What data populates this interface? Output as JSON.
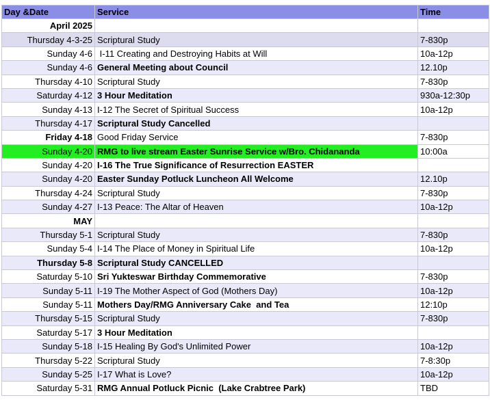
{
  "table": {
    "headers": {
      "date": "Day &Date",
      "service": "Service",
      "time": "Time"
    },
    "rows": [
      {
        "date": "April 2025",
        "service": "",
        "time": "",
        "date_bold": true,
        "service_bold": false,
        "shade": "white"
      },
      {
        "date": "Thursday 4-3-25",
        "service": "Scriptural Study",
        "time": "7-830p",
        "date_bold": false,
        "service_bold": false,
        "shade": "lilac"
      },
      {
        "date": "Sunday 4-6",
        "service": " I-11 Creating and Destroying Habits at Will",
        "time": "10a-12p",
        "date_bold": false,
        "service_bold": false,
        "shade": "white"
      },
      {
        "date": "Sunday 4-6",
        "service": "General Meeting about Council",
        "time": "12.10p",
        "date_bold": false,
        "service_bold": true,
        "shade": "lavender"
      },
      {
        "date": "Thursday 4-10",
        "service": "Scriptural Study",
        "time": "7-830p",
        "date_bold": false,
        "service_bold": false,
        "shade": "white"
      },
      {
        "date": "Saturday 4-12",
        "service": "3 Hour Meditation",
        "time": "930a-12:30p",
        "date_bold": false,
        "service_bold": true,
        "shade": "lavender"
      },
      {
        "date": "Sunday 4-13",
        "service": "I-12 The Secret of Spiritual Success",
        "time": "10a-12p",
        "date_bold": false,
        "service_bold": false,
        "shade": "white"
      },
      {
        "date": "Thursday 4-17",
        "service": "Scriptural Study Cancelled",
        "time": "",
        "date_bold": false,
        "service_bold": true,
        "shade": "lavender"
      },
      {
        "date": "Friday 4-18",
        "service": "Good Friday Service",
        "time": "7-830p",
        "date_bold": true,
        "service_bold": false,
        "shade": "white"
      },
      {
        "date": "Sunday 4-20",
        "service": "RMG to live stream Easter Sunrise Service w/Bro. Chidananda",
        "time": "10:00a",
        "date_bold": false,
        "service_bold": true,
        "shade": "green"
      },
      {
        "date": "Sunday 4-20",
        "service": "I-16 The True Significance of Resurrection EASTER",
        "time": "",
        "date_bold": false,
        "service_bold": true,
        "shade": "white"
      },
      {
        "date": "Sunday 4-20",
        "service": "Easter Sunday Potluck Luncheon All Welcome",
        "time": "12.10p",
        "date_bold": false,
        "service_bold": true,
        "shade": "lavender"
      },
      {
        "date": "Thursday 4-24",
        "service": "Scriptural Study",
        "time": "7-830p",
        "date_bold": false,
        "service_bold": false,
        "shade": "white"
      },
      {
        "date": "Sunday 4-27",
        "service": "I-13 Peace: The Altar of Heaven",
        "time": "10a-12p",
        "date_bold": false,
        "service_bold": false,
        "shade": "lavender"
      },
      {
        "date": "MAY",
        "service": "",
        "time": "",
        "date_bold": true,
        "service_bold": false,
        "shade": "white"
      },
      {
        "date": "Thursday 5-1",
        "service": "Scriptural Study",
        "time": "7-830p",
        "date_bold": false,
        "service_bold": false,
        "shade": "lavender"
      },
      {
        "date": "Sunday 5-4",
        "service": "I-14 The Place of Money in Spiritual Life",
        "time": "10a-12p",
        "date_bold": false,
        "service_bold": false,
        "shade": "white"
      },
      {
        "date": "Thursday 5-8",
        "service": "Scriptural Study CANCELLED",
        "time": "",
        "date_bold": true,
        "service_bold": true,
        "shade": "lavender"
      },
      {
        "date": "Saturday 5-10",
        "service": "Sri Yukteswar Birthday Commemorative",
        "time": "7-830p",
        "date_bold": false,
        "service_bold": true,
        "shade": "white"
      },
      {
        "date": "Sunday 5-11",
        "service": "I-19 The Mother Aspect of God (Mothers Day)",
        "time": "10a-12p",
        "date_bold": false,
        "service_bold": false,
        "shade": "lavender"
      },
      {
        "date": "Sunday 5-11",
        "service": "Mothers Day/RMG Anniversary Cake  and Tea",
        "time": "12:10p",
        "date_bold": false,
        "service_bold": true,
        "shade": "white"
      },
      {
        "date": "Thursday 5-15",
        "service": "Scriptural Study",
        "time": "7-830p",
        "date_bold": false,
        "service_bold": false,
        "shade": "lavender"
      },
      {
        "date": "Saturday 5-17",
        "service": "3 Hour Meditation",
        "time": "",
        "date_bold": false,
        "service_bold": true,
        "shade": "white"
      },
      {
        "date": "Sunday 5-18",
        "service": "I-15 Healing By God's Unlimited Power",
        "time": "10a-12p",
        "date_bold": false,
        "service_bold": false,
        "shade": "lavender"
      },
      {
        "date": "Thursday 5-22",
        "service": "Scriptural Study",
        "time": "7-8:30p",
        "date_bold": false,
        "service_bold": false,
        "shade": "white"
      },
      {
        "date": "Sunday 5-25",
        "service": "I-17 What is Love?",
        "time": "10a-12p",
        "date_bold": false,
        "service_bold": false,
        "shade": "lavender"
      },
      {
        "date": "Saturday 5-31",
        "service": "RMG Annual Potluck Picnic  (Lake Crabtree Park)",
        "time": "TBD",
        "date_bold": false,
        "service_bold": true,
        "shade": "white"
      }
    ]
  },
  "colors": {
    "header_bg": "#8b8ee6",
    "row_lavender": "#e9e9f9",
    "row_lilac": "#dddbee",
    "highlight_green": "#22ee22",
    "grid_line": "#c9c9d6"
  }
}
